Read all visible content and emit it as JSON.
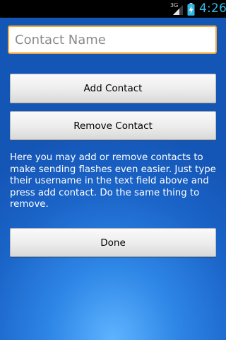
{
  "status_bar": {
    "network": "3G",
    "time": "4:26",
    "signal_icon": "signal-bars-icon",
    "battery_icon": "battery-charging-icon"
  },
  "contact_field": {
    "placeholder": "Contact Name",
    "value": ""
  },
  "buttons": {
    "add_label": "Add Contact",
    "remove_label": "Remove Contact",
    "done_label": "Done"
  },
  "instructions": "Here you may add or remove contacts to make sending flashes even easier. Just type their username in the text field above and press add contact. Do the same thing to remove.",
  "colors": {
    "accent_clock": "#33b5e5",
    "input_focus_border": "#f4a93a",
    "background_top": "#1456b6",
    "background_glow": "#5fb4ff"
  }
}
